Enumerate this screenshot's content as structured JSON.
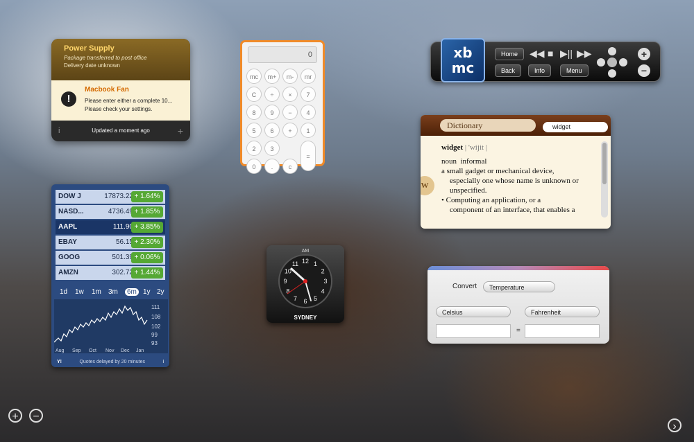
{
  "notifications": {
    "power": {
      "title": "Power Supply",
      "line1": "Package transferred to post office",
      "line2": "Delivery date unknown"
    },
    "alert": {
      "title": "Macbook Fan",
      "line1": "Please enter either a complete 10...",
      "line2": "Please check your settings."
    },
    "footer": "Updated a moment ago",
    "info_icon": "i",
    "add_icon": "+"
  },
  "calculator": {
    "display": "0",
    "keys": [
      "mc",
      "m+",
      "m-",
      "mr",
      "C",
      "÷",
      "×",
      "7",
      "8",
      "9",
      "−",
      "4",
      "5",
      "6",
      "+",
      "1",
      "2",
      "3",
      "=",
      "0",
      ".",
      "c"
    ]
  },
  "xbmc": {
    "logo_top": "xb",
    "logo_bottom": "mc",
    "home": "Home",
    "back": "Back",
    "info": "Info",
    "menu": "Menu",
    "transport": [
      "◀◀",
      "■",
      "▶||",
      "▶▶"
    ],
    "zoom_in": "+",
    "zoom_out": "−"
  },
  "dictionary": {
    "source": "Dictionary",
    "query": "widget",
    "headword": "widget",
    "pron": "| 'wijit |",
    "pos": "noun",
    "register": "informal",
    "def1a": "a small gadget or mechanical device,",
    "def1b": "especially one whose name is unknown or",
    "def1c": "unspecified.",
    "def2a": "• Computing an application, or a",
    "def2b": "component of an interface, that enables a",
    "seal": "W"
  },
  "stocks": {
    "rows": [
      {
        "symbol": "DOW J",
        "price": "17873.22",
        "change": "+ 1.64%"
      },
      {
        "symbol": "NASD...",
        "price": "4736.49",
        "change": "+ 1.85%"
      },
      {
        "symbol": "AAPL",
        "price": "111.90",
        "change": "+ 3.85%"
      },
      {
        "symbol": "EBAY",
        "price": "56.15",
        "change": "+ 2.30%"
      },
      {
        "symbol": "GOOG",
        "price": "501.39",
        "change": "+ 0.06%"
      },
      {
        "symbol": "AMZN",
        "price": "302.72",
        "change": "+ 1.44%"
      }
    ],
    "ranges": [
      "1d",
      "1w",
      "1m",
      "3m",
      "6m",
      "1y",
      "2y"
    ],
    "selected_range": "6m",
    "yticks": [
      "111",
      "108",
      "102",
      "99",
      "93"
    ],
    "months": [
      "Aug",
      "Sep",
      "Oct",
      "Nov",
      "Dec",
      "Jan"
    ],
    "footer": "Quotes delayed by 20 minutes",
    "logo": "Y!",
    "info_icon": "i"
  },
  "clock": {
    "ampm": "AM",
    "city": "SYDNEY",
    "numbers": [
      "12",
      "1",
      "2",
      "3",
      "4",
      "5",
      "6",
      "7",
      "8",
      "9",
      "10",
      "11"
    ]
  },
  "converter": {
    "convert_label": "Convert",
    "type": "Temperature",
    "from_unit": "Celsius",
    "to_unit": "Fahrenheit",
    "equals": "=",
    "from_value": "",
    "to_value": ""
  },
  "dashboard": {
    "add": "+",
    "remove": "−",
    "next": "›"
  }
}
